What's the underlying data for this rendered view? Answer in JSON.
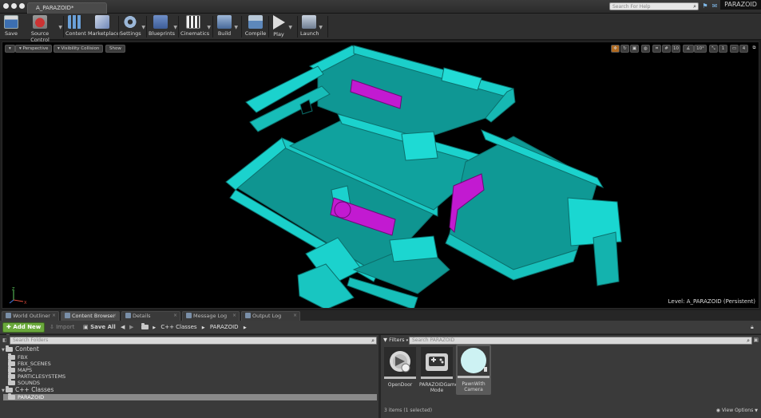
{
  "window": {
    "tab_title": "A_PARAZOID*",
    "help_search_placeholder": "Search For Help",
    "project_name": "PARAZOID"
  },
  "toolbar": {
    "save": "Save",
    "source_control": "Source Control",
    "content": "Content",
    "marketplace": "Marketplace",
    "settings": "Settings",
    "blueprints": "Blueprints",
    "cinematics": "Cinematics",
    "build": "Build",
    "compile": "Compile",
    "play": "Play",
    "launch": "Launch"
  },
  "viewport": {
    "perspective": "Perspective",
    "view_mode": "Visibility Collision",
    "show": "Show",
    "grid_size": "10",
    "rotation_snap": "10°",
    "scale_snap": "1",
    "camera_speed": "4",
    "level_label": "Level:  A_PARAZOID (Persistent)",
    "mesh_color": "#18c8c4",
    "highlight_color": "#c21ad1"
  },
  "panel_tabs": {
    "world_outliner": "World Outliner",
    "content_browser": "Content Browser",
    "details": "Details",
    "message_log": "Message Log",
    "output_log": "Output Log"
  },
  "content_browser": {
    "add_new": "Add New",
    "import": "Import",
    "save_all": "Save All",
    "breadcrumb": [
      "C++ Classes",
      "PARAZOID"
    ],
    "folder_search_placeholder": "Search Folders",
    "asset_search_placeholder": "Search PARAZOID",
    "filters": "Filters",
    "tree": [
      {
        "label": "Content",
        "level": 0,
        "expanded": true
      },
      {
        "label": "FBX",
        "level": 1
      },
      {
        "label": "FBX_SCENES",
        "level": 1
      },
      {
        "label": "MAPS",
        "level": 1
      },
      {
        "label": "PARTICLESYSTEMS",
        "level": 1
      },
      {
        "label": "SOUNDS",
        "level": 1
      },
      {
        "label": "C++ Classes",
        "level": 0,
        "expanded": true
      },
      {
        "label": "PARAZOID",
        "level": 1,
        "selected": true
      }
    ],
    "assets": [
      {
        "name": "OpenDoor",
        "icon": "actor-component-icon",
        "selected": false
      },
      {
        "name": "PARAZOIDGame Mode",
        "icon": "game-mode-icon",
        "selected": false
      },
      {
        "name": "PawnWith Camera",
        "icon": "pawn-icon",
        "selected": true
      }
    ],
    "status": "3 items (1 selected)",
    "view_options": "View Options"
  }
}
